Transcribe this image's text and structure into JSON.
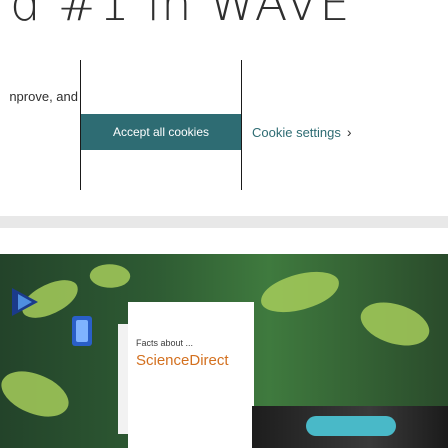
{
  "background": {
    "headline": "d #1 in WAVE"
  },
  "cookie_banner": {
    "text_lines": [
      "nprove, and"
    ],
    "accept_label": "Accept all cookies",
    "settings_label": "Cookie settings",
    "settings_icon": "chevron-right-icon",
    "accent_color": "#2e6c73"
  },
  "promo": {
    "teaser_text": "Facts about ...",
    "brand": "ScienceDirect",
    "brand_color": "#d3701f"
  }
}
